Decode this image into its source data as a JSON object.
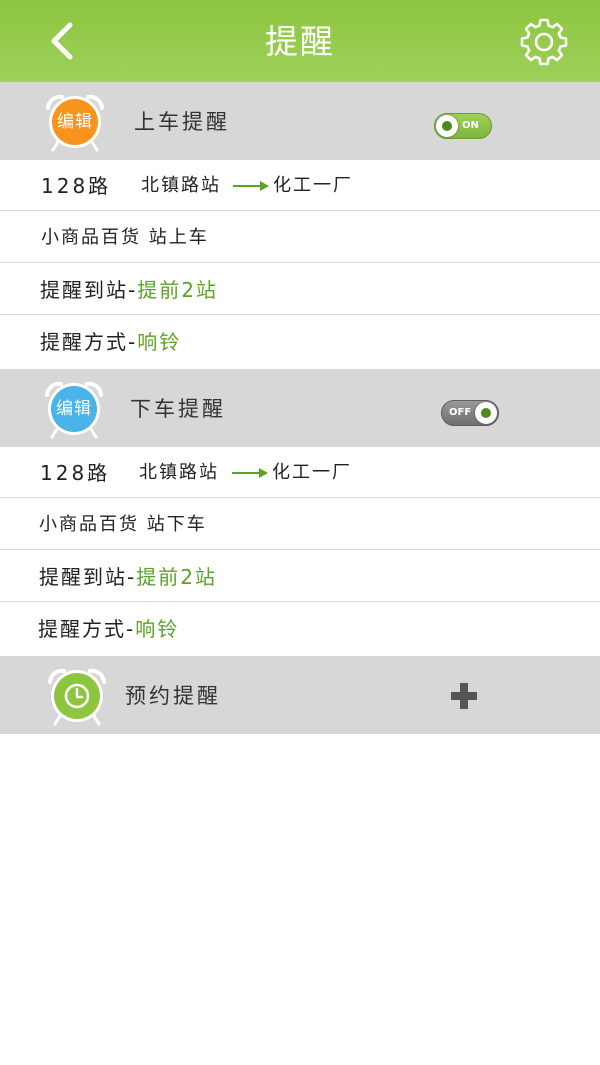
{
  "header": {
    "title": "提醒"
  },
  "colors": {
    "header_green": "#8cc63f",
    "accent_green": "#5aa324",
    "orange": "#f7941d",
    "blue": "#4ab3e8",
    "lime": "#8cc63f",
    "section_gray": "#d7d7d7"
  },
  "icons": {
    "back": "chevron-left-icon",
    "settings": "gear-icon",
    "boarding": "alarm-clock-icon",
    "alighting": "alarm-clock-icon",
    "reservation": "alarm-clock-icon",
    "add": "plus-icon"
  },
  "boarding": {
    "title": "上车提醒",
    "badge": "编辑",
    "toggle_label": "ON",
    "toggle_state": true,
    "route": "128路",
    "from": "北镇路站",
    "to": "化工一厂",
    "stop_line": "小商品百货 站上车",
    "alert_label": "提醒到站",
    "sep1": "-",
    "alert_value": "提前2站",
    "mode_label": "提醒方式",
    "sep2": "-",
    "mode_value": "响铃"
  },
  "alighting": {
    "title": "下车提醒",
    "badge": "编辑",
    "toggle_label": "OFF",
    "toggle_state": false,
    "route": "128路",
    "from": "北镇路站",
    "to": "化工一厂",
    "stop_line": "小商品百货 站下车",
    "alert_label": "提醒到站",
    "sep1": "-",
    "alert_value": "提前2站",
    "mode_label": "提醒方式",
    "sep2": "-",
    "mode_value": "响铃"
  },
  "reservation": {
    "title": "预约提醒"
  }
}
